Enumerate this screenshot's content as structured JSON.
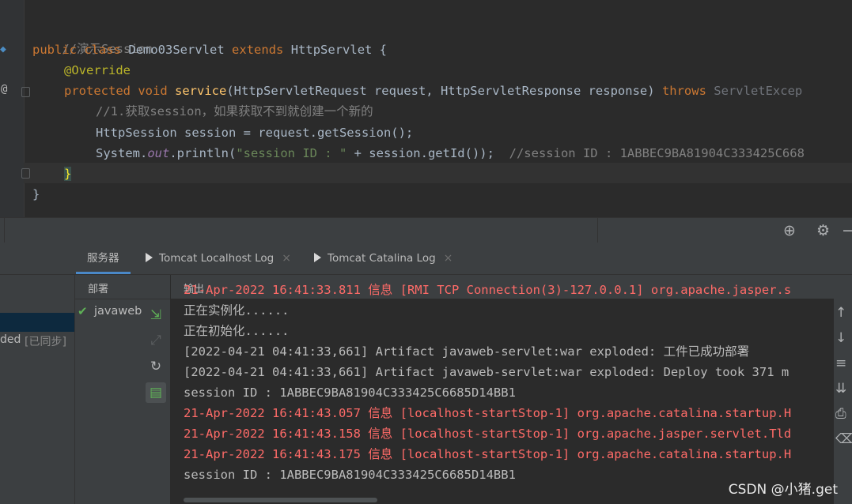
{
  "editor": {
    "lines": [
      {
        "comment": "//演示Session"
      },
      {
        "kw_public": "public",
        "kw_class": "class",
        "class_name": "Demo03Servlet",
        "kw_extends": "extends",
        "parent": "HttpServlet {"
      },
      {
        "annotation": "@Override"
      },
      {
        "kw_protected": "protected",
        "kw_void": "void",
        "method": "service",
        "params": "(HttpServletRequest request, HttpServletResponse response)",
        "kw_throws": "throws",
        "exception": "ServletExcep"
      },
      {
        "comment": "//1.获取session，如果获取不到就创建一个新的"
      },
      {
        "code": "HttpSession session = request.getSession();"
      },
      {
        "prefix": "System.",
        "field": "out",
        "middle": ".println(",
        "string": "\"session ID : \"",
        "suffix": " + session.getId());",
        "comment": "//session ID : 1ABBEC9BA81904C333425C668"
      },
      {
        "brace": "}"
      },
      {
        "brace": "}"
      }
    ],
    "gutter_marker": "@"
  },
  "tool_window": {
    "tabs": [
      {
        "label": "服务器",
        "active": true
      },
      {
        "label": "Tomcat Localhost Log",
        "close": "×"
      },
      {
        "label": "Tomcat Catalina Log",
        "close": "×"
      }
    ],
    "left_items": [
      {
        "text": "ded"
      },
      {
        "text": "[已同步]"
      }
    ],
    "deploy_header": "部署",
    "deploy_item": "javaweb",
    "check": "✔",
    "output_header": "输出",
    "output_lines": [
      {
        "text": "21-Apr-2022 16:41:33.811 信息 [RMI TCP Connection(3)-127.0.0.1] org.apache.jasper.s",
        "style": "red"
      },
      {
        "text": "正在实例化......",
        "style": "normal"
      },
      {
        "text": "正在初始化......",
        "style": "normal"
      },
      {
        "text": "[2022-04-21 04:41:33,661] Artifact javaweb-servlet:war exploded: 工件已成功部署",
        "style": "normal"
      },
      {
        "text": "[2022-04-21 04:41:33,661] Artifact javaweb-servlet:war exploded: Deploy took 371 m",
        "style": "normal"
      },
      {
        "text": "session ID : 1ABBEC9BA81904C333425C6685D14BB1",
        "style": "normal"
      },
      {
        "text": "21-Apr-2022 16:41:43.057 信息 [localhost-startStop-1] org.apache.catalina.startup.H",
        "style": "red"
      },
      {
        "text": "21-Apr-2022 16:41:43.158 信息 [localhost-startStop-1] org.apache.jasper.servlet.Tld",
        "style": "red"
      },
      {
        "text": "21-Apr-2022 16:41:43.175 信息 [localhost-startStop-1] org.apache.catalina.startup.H",
        "style": "red"
      },
      {
        "text": "session ID : 1ABBEC9BA81904C333425C6685D14BB1",
        "style": "normal"
      }
    ]
  },
  "icons": {
    "target": "⊕",
    "gear": "⚙",
    "minimize": "−",
    "deploy": "⇲",
    "redeploy": "↻",
    "scroll_up": "↑",
    "scroll_down": "↓",
    "wrap": "≡",
    "print": "⎙"
  },
  "watermark": "CSDN @小猪.get",
  "colors": {
    "accent": "#4a88c7",
    "error": "#ff6b68",
    "keyword": "#cc7832",
    "function": "#ffc66d",
    "string": "#6a8759"
  }
}
